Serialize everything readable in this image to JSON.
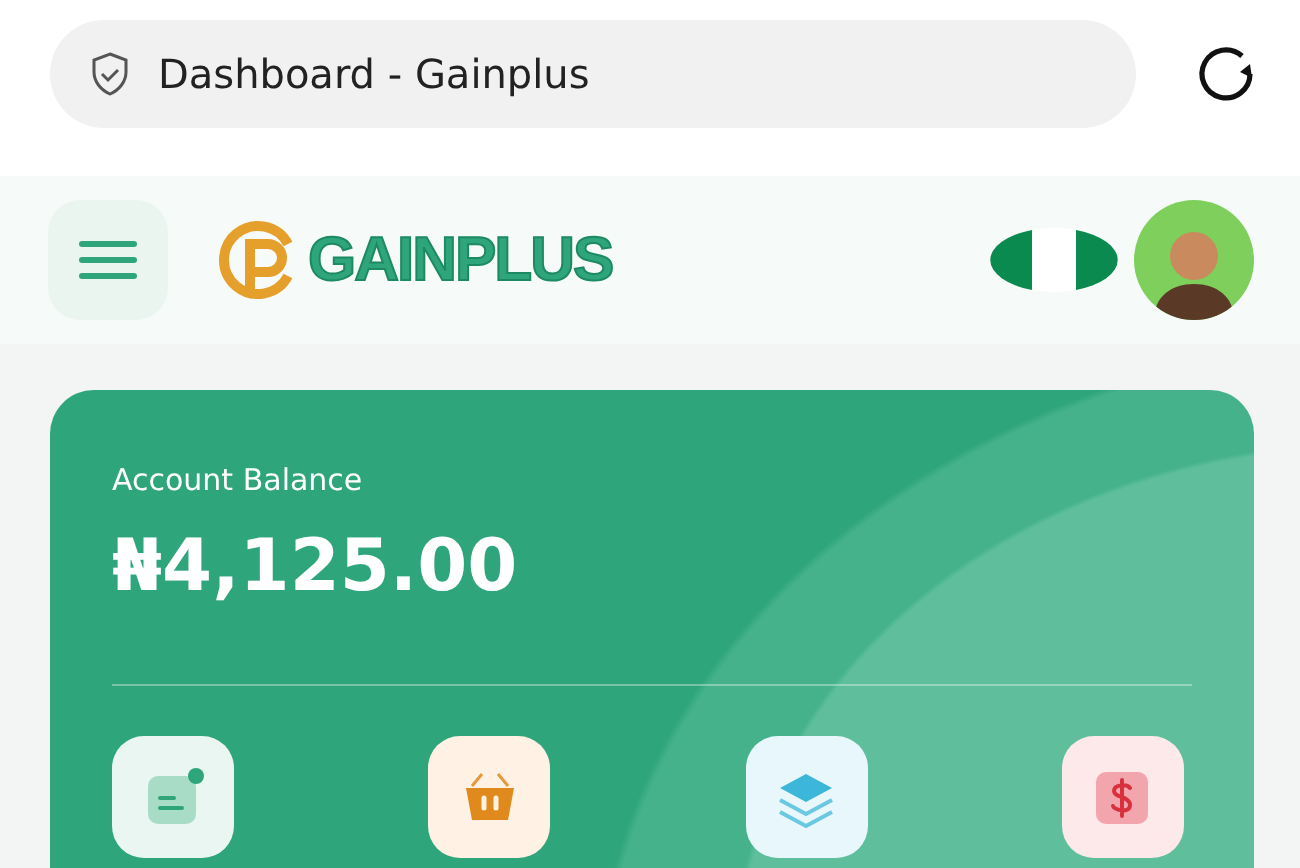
{
  "browser": {
    "title": "Dashboard - Gainplus"
  },
  "header": {
    "logo": "GAINPLUS"
  },
  "balance": {
    "label": "Account Balance",
    "amount": "₦4,125.00"
  },
  "actions": [
    {
      "kind": "note"
    },
    {
      "kind": "basket"
    },
    {
      "kind": "layers"
    },
    {
      "kind": "dollar"
    }
  ]
}
